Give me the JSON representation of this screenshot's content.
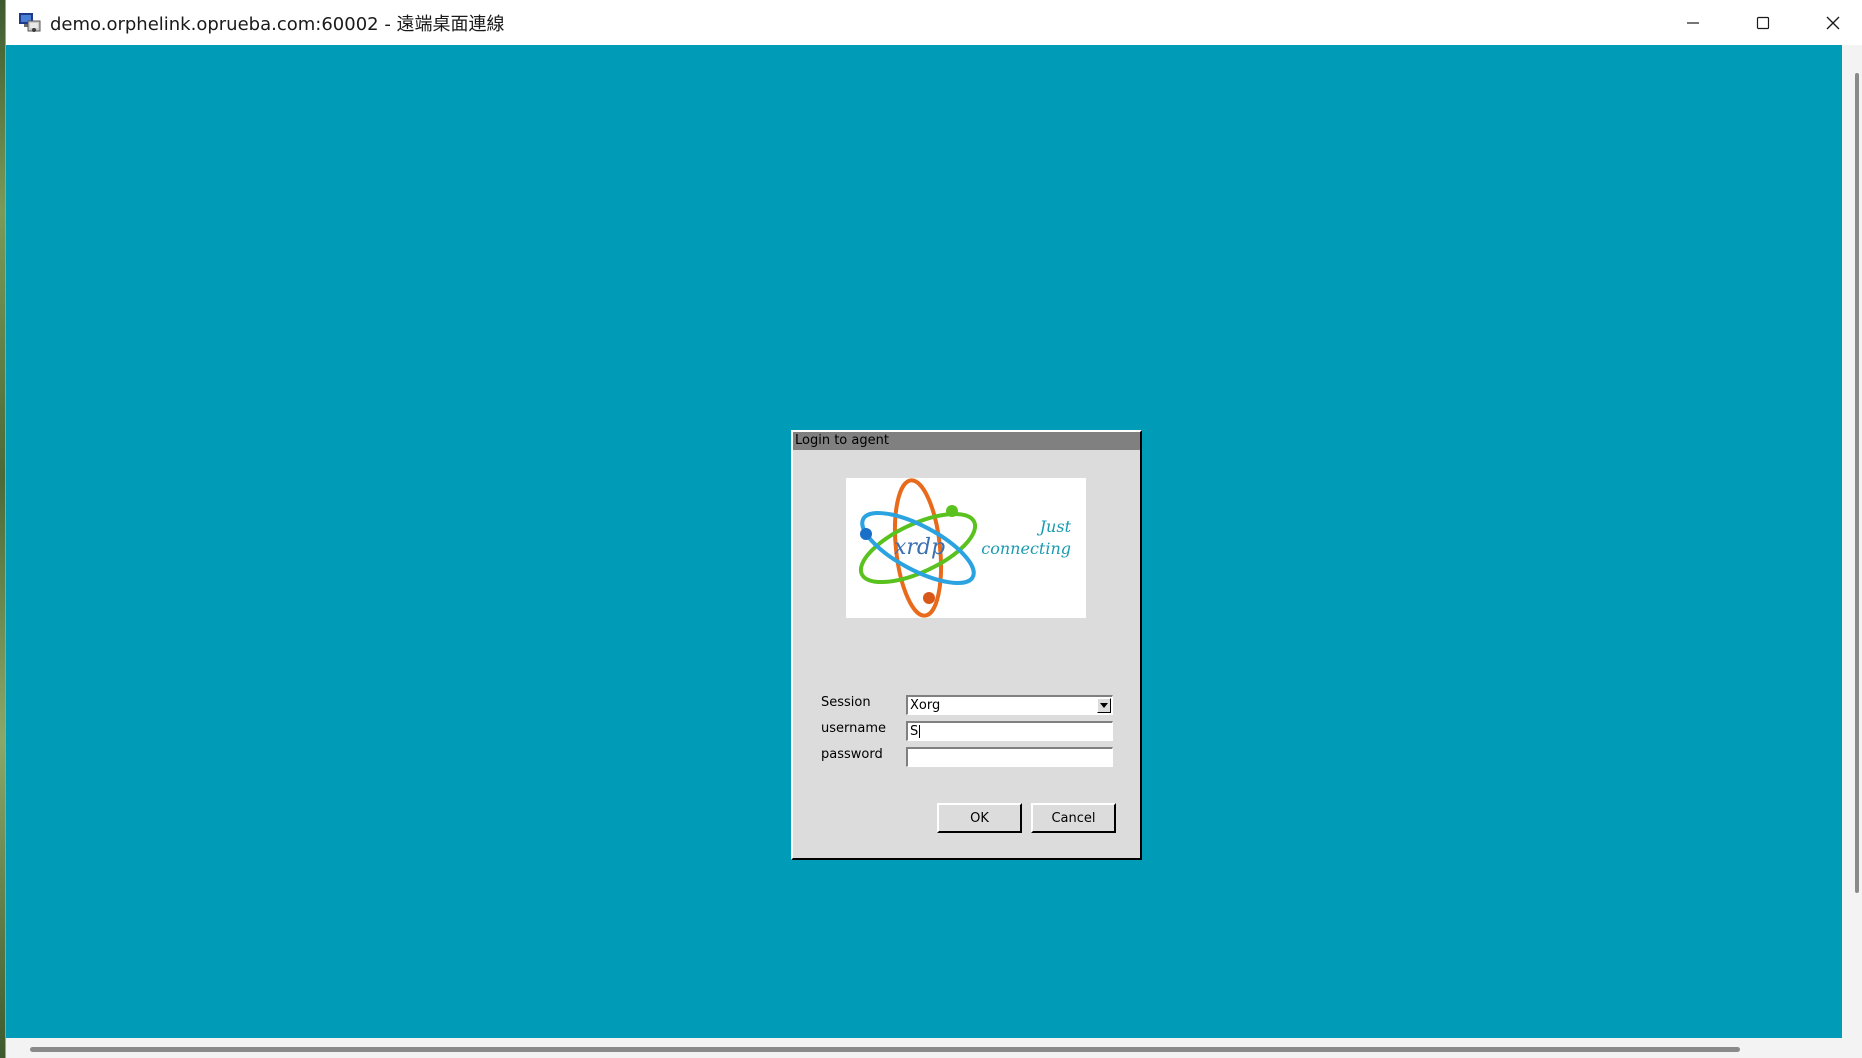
{
  "window": {
    "title": "demo.orphelink.oprueba.com:60002 - 遠端桌面連線",
    "icon": "remote-desktop-icon",
    "controls": {
      "minimize_icon": "minimize-icon",
      "maximize_icon": "maximize-icon",
      "close_icon": "close-icon"
    }
  },
  "colors": {
    "desktop_background": "#009bb7",
    "dialog_background": "#dcdcdc",
    "dialog_titlebar": "#808080"
  },
  "login_dialog": {
    "title": "Login to agent",
    "logo": {
      "name": "xrdp",
      "tagline_line1": "Just",
      "tagline_line2": "connecting"
    },
    "session": {
      "label": "Session",
      "value": "Xorg"
    },
    "username": {
      "label": "username",
      "value": "S"
    },
    "password": {
      "label": "password",
      "value": ""
    },
    "buttons": {
      "ok": "OK",
      "cancel": "Cancel"
    }
  }
}
